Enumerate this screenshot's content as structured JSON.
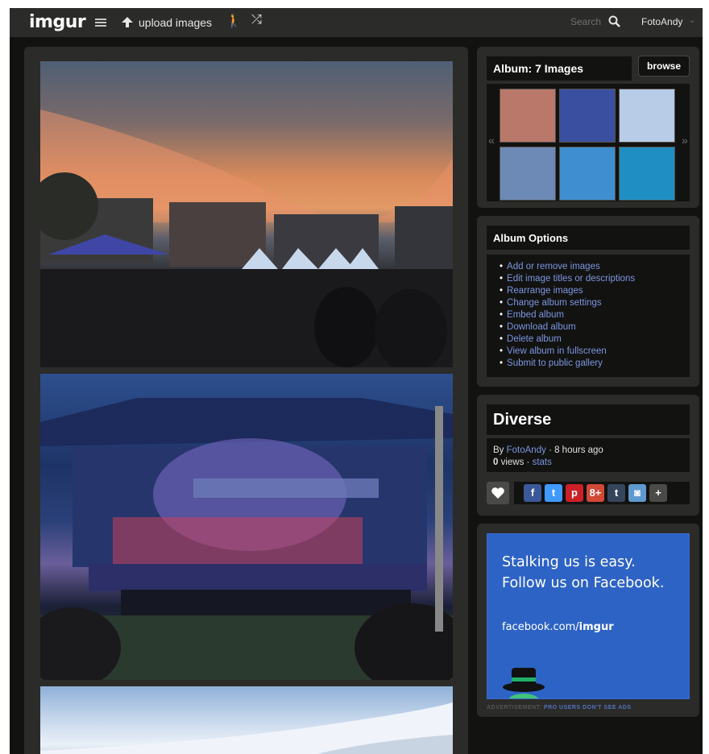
{
  "topbar": {
    "logo": "imgur",
    "upload_label": "upload images",
    "search_placeholder": "Search",
    "username": "FotoAndy"
  },
  "album": {
    "title": "Album: 7 Images",
    "browse_label": "browse",
    "prev_arrow": "«",
    "next_arrow": "»",
    "thumbnails": [
      {
        "name": "thumb-sunset-square",
        "color": "#b9786a"
      },
      {
        "name": "thumb-stage-show",
        "color": "#3b4fa0"
      },
      {
        "name": "thumb-snow-slope",
        "color": "#b8cce8"
      },
      {
        "name": "thumb-city-snow",
        "color": "#6d89b6"
      },
      {
        "name": "thumb-underwater-bird",
        "color": "#3f8fd0"
      },
      {
        "name": "thumb-underwater-diver",
        "color": "#1f8fc3"
      }
    ]
  },
  "options": {
    "title": "Album Options",
    "items": [
      "Add or remove images",
      "Edit image titles or descriptions",
      "Rearrange images",
      "Change album settings",
      "Embed album",
      "Download album",
      "Delete album",
      "View album in fullscreen",
      "Submit to public gallery"
    ]
  },
  "info": {
    "title": "Diverse",
    "by": "By",
    "author": "FotoAndy",
    "time": "· 8 hours ago",
    "views_count": "0",
    "views_label": "views ·",
    "stats_label": "stats",
    "share": [
      {
        "name": "facebook-share-button",
        "glyph": "f",
        "color": "#3b5998"
      },
      {
        "name": "twitter-share-button",
        "glyph": "t",
        "color": "#4099ff"
      },
      {
        "name": "pinterest-share-button",
        "glyph": "p",
        "color": "#cb2027"
      },
      {
        "name": "google-plus-share-button",
        "glyph": "8+",
        "color": "#d34836"
      },
      {
        "name": "tumblr-share-button",
        "glyph": "t",
        "color": "#35465c"
      },
      {
        "name": "reddit-share-button",
        "glyph": "◙",
        "color": "#5f99cf"
      },
      {
        "name": "more-share-button",
        "glyph": "+",
        "color": "#4a4a48"
      }
    ]
  },
  "ad": {
    "line1": "Stalking us is easy.",
    "line2": "Follow us on Facebook.",
    "url_prefix": "facebook.com/",
    "url_bold": "imgur",
    "note_prefix": "ADVERTISEMENT:",
    "note_link": "PRO USERS DON'T SEE ADS"
  }
}
